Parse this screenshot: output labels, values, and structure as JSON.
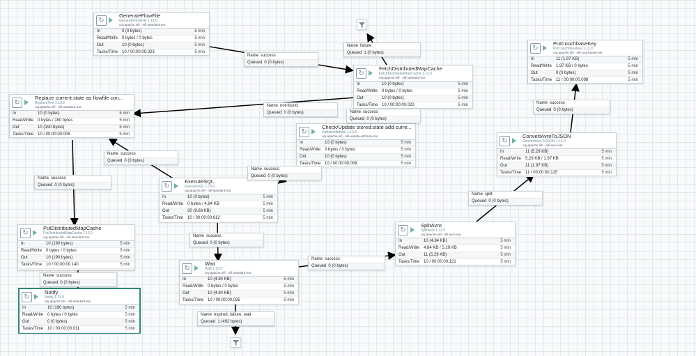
{
  "canvas": {
    "grid": true,
    "accent_selected": "#2b8a76",
    "running_color": "#6fb29f"
  },
  "processors": {
    "generate": {
      "name": "GenerateFlowFile",
      "type": "GenerateFlowFile 1.13.0",
      "bundle": "org.apache.nifi - nifi-standard-nar",
      "stats": [
        {
          "label": "In",
          "value": "0 (0 bytes)",
          "time": "5 min"
        },
        {
          "label": "Read/Write",
          "value": "0 bytes / 0 bytes",
          "time": "5 min"
        },
        {
          "label": "Out",
          "value": "10 (0 bytes)",
          "time": "5 min"
        },
        {
          "label": "Tasks/Time",
          "value": "10 / 00:00:00.023",
          "time": "5 min"
        }
      ]
    },
    "fetch": {
      "name": "FetchDistributedMapCache",
      "type": "FetchDistributedMapCache 1.13.0",
      "bundle": "org.apache.nifi - nifi-standard-nar",
      "stats": [
        {
          "label": "In",
          "value": "10 (0 bytes)",
          "time": "5 min"
        },
        {
          "label": "Read/Write",
          "value": "0 bytes / 0 bytes",
          "time": "5 min"
        },
        {
          "label": "Out",
          "value": "10 (0 bytes)",
          "time": "5 min"
        },
        {
          "label": "Tasks/Time",
          "value": "10 / 00:00:00.022",
          "time": "5 min"
        }
      ]
    },
    "replace": {
      "name": "Replace current.state as flowfile con...",
      "type": "ReplaceText 1.13.0",
      "bundle": "org.apache.nifi - nifi-standard-nar",
      "stats": [
        {
          "label": "In",
          "value": "10 (0 bytes)",
          "time": "5 min"
        },
        {
          "label": "Read/Write",
          "value": "0 bytes / 190 bytes",
          "time": "5 min"
        },
        {
          "label": "Out",
          "value": "10 (190 bytes)",
          "time": "5 min"
        },
        {
          "label": "Tasks/Time",
          "value": "10 / 00:00:00.005",
          "time": "5 min"
        }
      ]
    },
    "check": {
      "name": "Check/Update stored.state add curre...",
      "type": "UpdateAttribute 1.13.0",
      "bundle": "org.apache.nifi - nifi-update-attribute-nar",
      "stats": [
        {
          "label": "In",
          "value": "10 (0 bytes)",
          "time": "5 min"
        },
        {
          "label": "Read/Write",
          "value": "0 bytes / 0 bytes",
          "time": "5 min"
        },
        {
          "label": "Out",
          "value": "10 (0 bytes)",
          "time": "5 min"
        },
        {
          "label": "Tasks/Time",
          "value": "10 / 00:00:00.008",
          "time": "5 min"
        }
      ]
    },
    "execute": {
      "name": "ExecuteSQL",
      "type": "ExecuteSQL 1.13.0",
      "bundle": "org.apache.nifi - nifi-standard-nar",
      "stats": [
        {
          "label": "In",
          "value": "10 (0 bytes)",
          "time": "5 min"
        },
        {
          "label": "Read/Write",
          "value": "0 bytes / 4.84 KB",
          "time": "5 min"
        },
        {
          "label": "Out",
          "value": "20 (9.68 KB)",
          "time": "5 min"
        },
        {
          "label": "Tasks/Time",
          "value": "10 / 00:00:00.612",
          "time": "5 min"
        }
      ]
    },
    "putdist": {
      "name": "PutDistributedMapCache",
      "type": "PutDistributedMapCache 1.13.0",
      "bundle": "org.apache.nifi - nifi-standard-nar",
      "stats": [
        {
          "label": "In",
          "value": "10 (190 bytes)",
          "time": "5 min"
        },
        {
          "label": "Read/Write",
          "value": "0 bytes / 0 bytes",
          "time": "5 min"
        },
        {
          "label": "Out",
          "value": "10 (190 bytes)",
          "time": "5 min"
        },
        {
          "label": "Tasks/Time",
          "value": "10 / 00:00:00.140",
          "time": "5 min"
        }
      ]
    },
    "notify": {
      "name": "Notify",
      "type": "Notify 1.13.0",
      "bundle": "org.apache.nifi - nifi-standard-nar",
      "stats": [
        {
          "label": "In",
          "value": "10 (190 bytes)",
          "time": "5 min"
        },
        {
          "label": "Read/Write",
          "value": "0 bytes / 0 bytes",
          "time": "5 min"
        },
        {
          "label": "Out",
          "value": "0 (0 bytes)",
          "time": "5 min"
        },
        {
          "label": "Tasks/Time",
          "value": "10 / 00:00:00.011",
          "time": "5 min"
        }
      ]
    },
    "wait": {
      "name": "Wait",
      "type": "Wait 1.13.0",
      "bundle": "org.apache.nifi - nifi-standard-nar",
      "stats": [
        {
          "label": "In",
          "value": "10 (4.84 KB)",
          "time": "5 min"
        },
        {
          "label": "Read/Write",
          "value": "0 bytes / 0 bytes",
          "time": "5 min"
        },
        {
          "label": "Out",
          "value": "10 (4.84 KB)",
          "time": "5 min"
        },
        {
          "label": "Tasks/Time",
          "value": "10 / 00:00:00.025",
          "time": "5 min"
        }
      ]
    },
    "split": {
      "name": "SplitAvro",
      "type": "SplitAvro 1.13.0",
      "bundle": "org.apache.nifi - nifi-avro-nar",
      "stats": [
        {
          "label": "In",
          "value": "10 (4.84 KB)",
          "time": "5 min"
        },
        {
          "label": "Read/Write",
          "value": "4.84 KB / 5.29 KB",
          "time": "5 min"
        },
        {
          "label": "Out",
          "value": "11 (5.29 KB)",
          "time": "5 min"
        },
        {
          "label": "Tasks/Time",
          "value": "10 / 00:00:00.121",
          "time": "5 min"
        }
      ]
    },
    "convert": {
      "name": "ConvertAvroToJSON",
      "type": "ConvertAvroToJSON 1.13.0",
      "bundle": "org.apache.nifi - nifi-avro-nar",
      "stats": [
        {
          "label": "In",
          "value": "11 (5.29 KB)",
          "time": "5 min"
        },
        {
          "label": "Read/Write",
          "value": "5.29 KB / 1.97 KB",
          "time": "5 min"
        },
        {
          "label": "Out",
          "value": "11 (1.97 KB)",
          "time": "5 min"
        },
        {
          "label": "Tasks/Time",
          "value": "11 / 00:00:00.125",
          "time": "5 min"
        }
      ]
    },
    "putcouch": {
      "name": "PutCouchbaseKey",
      "type": "PutCouchbaseKey 1.13.0",
      "bundle": "org.apache.nifi - nifi-couchbase-nar",
      "stats": [
        {
          "label": "In",
          "value": "11 (1.97 KB)",
          "time": "5 min"
        },
        {
          "label": "Read/Write",
          "value": "1.97 KB / 0 bytes",
          "time": "5 min"
        },
        {
          "label": "Out",
          "value": "0 (0 bytes)",
          "time": "5 min"
        },
        {
          "label": "Tasks/Time",
          "value": "11 / 00:00:00.098",
          "time": "5 min"
        }
      ]
    }
  },
  "connections": {
    "gen_fetch": {
      "name_label": "Name",
      "name": "success",
      "queued_label": "Queued",
      "queued": "0 (0 bytes)"
    },
    "fetch_failure": {
      "name_label": "Name",
      "name": "failure",
      "queued_label": "Queued",
      "queued": "1 (0 bytes)"
    },
    "fetch_notfound": {
      "name_label": "Name",
      "name": "not-found",
      "queued_label": "Queued",
      "queued": "0 (0 bytes)"
    },
    "fetch_check": {
      "name_label": "Name",
      "name": "success",
      "queued_label": "Queued",
      "queued": "0 (0 bytes)"
    },
    "check_exec": {
      "name_label": "Name",
      "name": "success",
      "queued_label": "Queued",
      "queued": "0 (0 bytes)"
    },
    "exec_replace": {
      "name_label": "Name",
      "name": "success",
      "queued_label": "Queued",
      "queued": "0 (0 bytes)"
    },
    "replace_put": {
      "name_label": "Name",
      "name": "success",
      "queued_label": "Queued",
      "queued": "0 (0 bytes)"
    },
    "put_notify": {
      "name_label": "Name",
      "name": "success",
      "queued_label": "Queued",
      "queued": "0 (0 bytes)"
    },
    "exec_wait": {
      "name_label": "Name",
      "name": "success",
      "queued_label": "Queued",
      "queued": "0 (0 bytes)"
    },
    "wait_split": {
      "name_label": "Name",
      "name": "success",
      "queued_label": "Queued",
      "queued": "0 (0 bytes)"
    },
    "wait_funnel": {
      "name_label": "Name",
      "name": "expired, failure, wait",
      "queued_label": "Queued",
      "queued": "1 (492 bytes)"
    },
    "split_convert": {
      "name_label": "Name",
      "name": "split",
      "queued_label": "Queued",
      "queued": "0 (0 bytes)"
    },
    "convert_put": {
      "name_label": "Name",
      "name": "success",
      "queued_label": "Queued",
      "queued": "0 (0 bytes)"
    }
  }
}
